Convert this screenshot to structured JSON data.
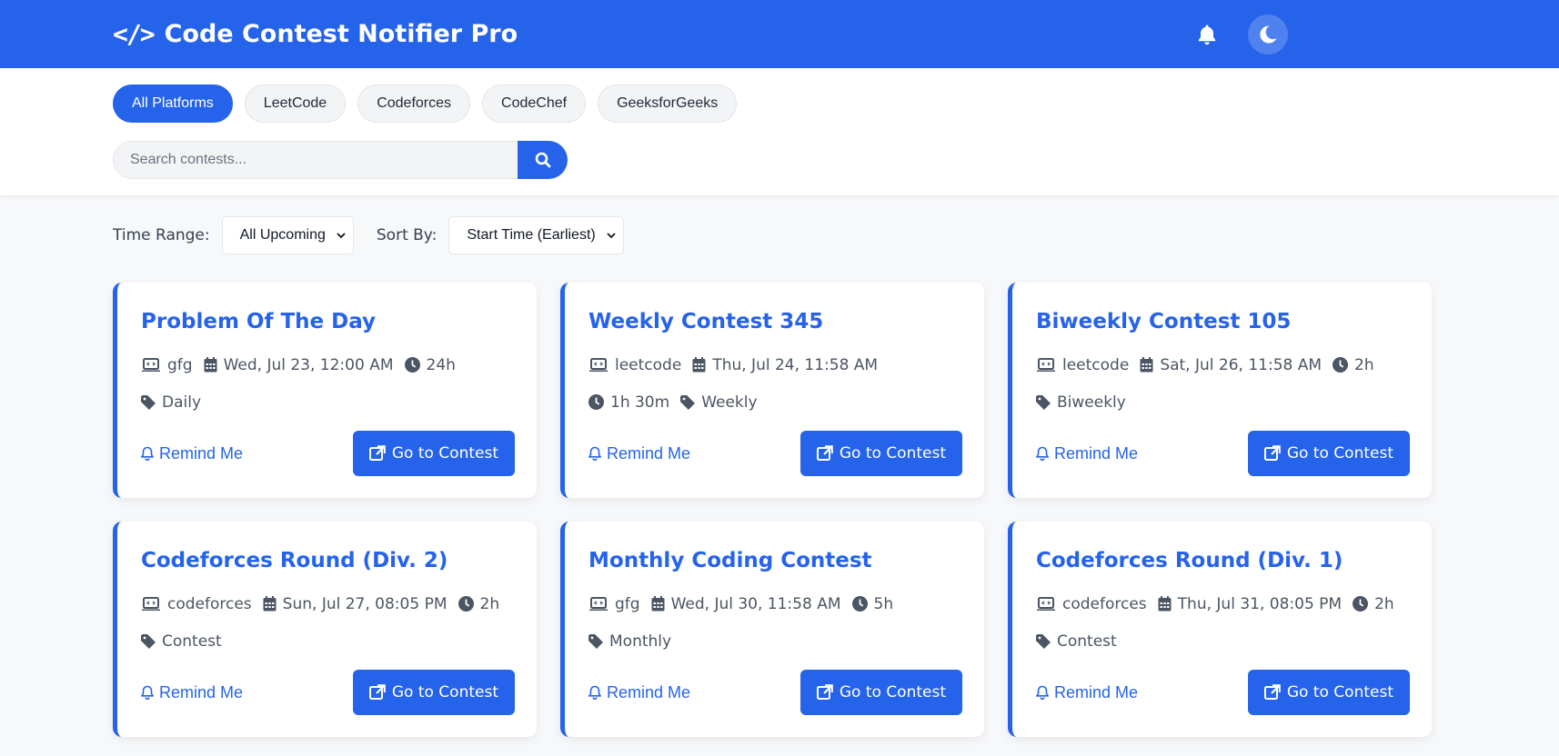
{
  "header": {
    "title": "Code Contest Notifier Pro",
    "logo_icon": "code-icon",
    "actions": [
      "bell-icon",
      "moon-icon"
    ]
  },
  "platforms": [
    {
      "label": "All Platforms",
      "active": true
    },
    {
      "label": "LeetCode",
      "active": false
    },
    {
      "label": "Codeforces",
      "active": false
    },
    {
      "label": "CodeChef",
      "active": false
    },
    {
      "label": "GeeksforGeeks",
      "active": false
    }
  ],
  "search": {
    "placeholder": "Search contests...",
    "value": ""
  },
  "controls": {
    "time_range_label": "Time Range:",
    "time_range_value": "All Upcoming",
    "sort_label": "Sort By:",
    "sort_value": "Start Time (Earliest)"
  },
  "actions": {
    "remind_label": "Remind Me",
    "go_label": "Go to Contest"
  },
  "contests": [
    {
      "title": "Problem Of The Day",
      "platform": "gfg",
      "date": "Wed, Jul 23, 12:00 AM",
      "duration": "24h",
      "tag": "Daily"
    },
    {
      "title": "Weekly Contest 345",
      "platform": "leetcode",
      "date": "Thu, Jul 24, 11:58 AM",
      "duration": "1h 30m",
      "tag": "Weekly"
    },
    {
      "title": "Biweekly Contest 105",
      "platform": "leetcode",
      "date": "Sat, Jul 26, 11:58 AM",
      "duration": "2h",
      "tag": "Biweekly"
    },
    {
      "title": "Codeforces Round (Div. 2)",
      "platform": "codeforces",
      "date": "Sun, Jul 27, 08:05 PM",
      "duration": "2h",
      "tag": "Contest"
    },
    {
      "title": "Monthly Coding Contest",
      "platform": "gfg",
      "date": "Wed, Jul 30, 11:58 AM",
      "duration": "5h",
      "tag": "Monthly"
    },
    {
      "title": "Codeforces Round (Div. 1)",
      "platform": "codeforces",
      "date": "Thu, Jul 31, 08:05 PM",
      "duration": "2h",
      "tag": "Contest"
    }
  ],
  "colors": {
    "primary": "#2563eb",
    "background": "#f7f8fa"
  }
}
